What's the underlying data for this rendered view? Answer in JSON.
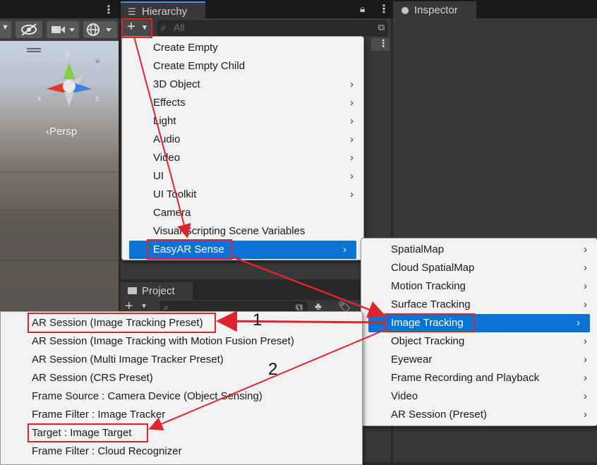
{
  "hierarchy": {
    "tab_title": "Hierarchy",
    "search_placeholder": "All",
    "add_button": "+"
  },
  "inspector": {
    "tab_title": "Inspector"
  },
  "project": {
    "tab_title": "Project"
  },
  "scene": {
    "persp_label": "‹Persp",
    "axis_y": "y",
    "axis_x": "x",
    "axis_z": "z"
  },
  "create_menu": {
    "items": [
      {
        "label": "Create Empty",
        "submenu": false
      },
      {
        "label": "Create Empty Child",
        "submenu": false
      },
      {
        "label": "3D Object",
        "submenu": true
      },
      {
        "label": "Effects",
        "submenu": true
      },
      {
        "label": "Light",
        "submenu": true
      },
      {
        "label": "Audio",
        "submenu": true
      },
      {
        "label": "Video",
        "submenu": true
      },
      {
        "label": "UI",
        "submenu": true
      },
      {
        "label": "UI Toolkit",
        "submenu": true
      },
      {
        "label": "Camera",
        "submenu": false
      },
      {
        "label": "Visual Scripting Scene Variables",
        "submenu": false
      },
      {
        "label": "EasyAR Sense",
        "submenu": true,
        "selected": true
      }
    ]
  },
  "easyar_menu": {
    "items": [
      {
        "label": "SpatialMap",
        "submenu": true
      },
      {
        "label": "Cloud SpatialMap",
        "submenu": true
      },
      {
        "label": "Motion Tracking",
        "submenu": true
      },
      {
        "label": "Surface Tracking",
        "submenu": true
      },
      {
        "label": "Image Tracking",
        "submenu": true,
        "selected": true
      },
      {
        "label": "Object Tracking",
        "submenu": true
      },
      {
        "label": "Eyewear",
        "submenu": true
      },
      {
        "label": "Frame Recording and Playback",
        "submenu": true
      },
      {
        "label": "Video",
        "submenu": true
      },
      {
        "label": "AR Session (Preset)",
        "submenu": true
      }
    ]
  },
  "image_tracking_menu": {
    "items": [
      {
        "label": "AR Session (Image Tracking Preset)"
      },
      {
        "label": "AR Session (Image Tracking with Motion Fusion Preset)"
      },
      {
        "label": "AR Session (Multi Image Tracker Preset)"
      },
      {
        "label": "AR Session (CRS Preset)"
      },
      {
        "label": "Frame Source : Camera Device (Object Sensing)"
      },
      {
        "label": "Frame Filter : Image Tracker"
      },
      {
        "label": "Target : Image Target"
      },
      {
        "label": "Frame Filter : Cloud Recognizer"
      }
    ]
  },
  "annotations": {
    "step1": "1",
    "step2": "2",
    "color": "#e0242d"
  },
  "colors": {
    "selection": "#0a74d6",
    "menu_bg": "#f2f2f2",
    "panel_bg": "#383838"
  }
}
